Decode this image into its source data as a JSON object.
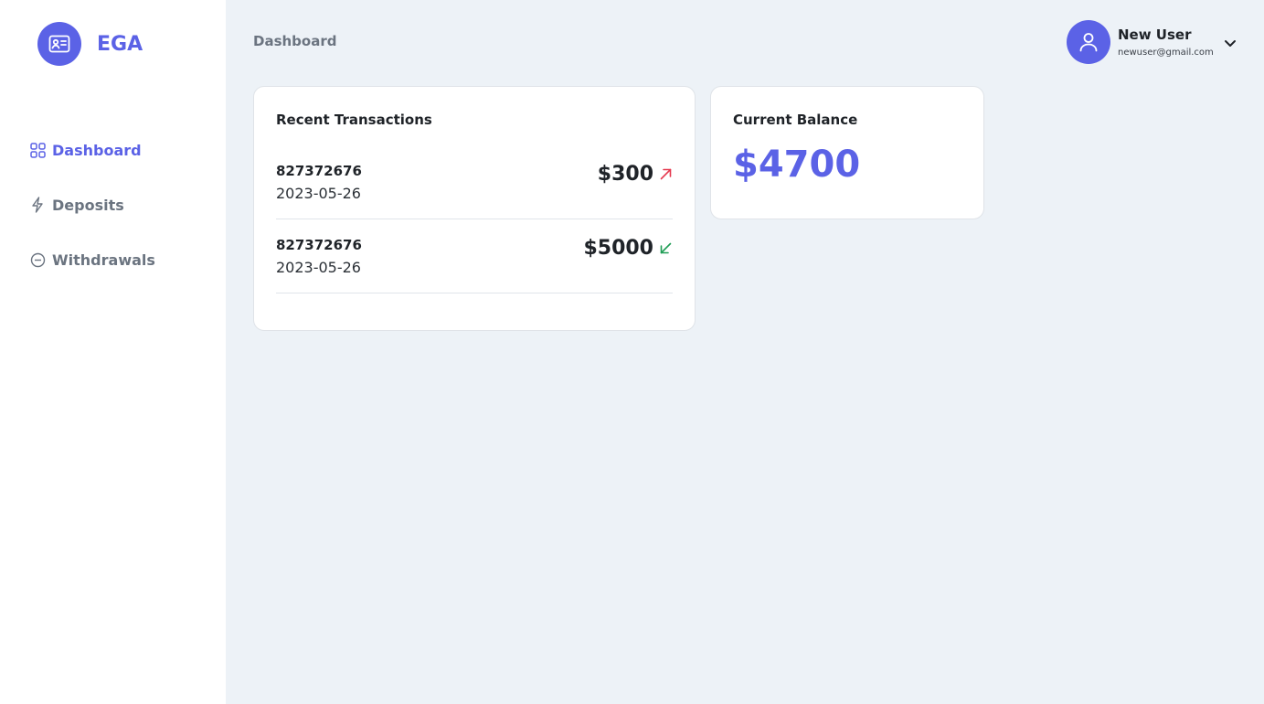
{
  "brand": {
    "name": "EGA",
    "logo_icon": "id-card-icon"
  },
  "sidebar": {
    "items": [
      {
        "label": "Dashboard",
        "icon": "grid-icon",
        "active": true
      },
      {
        "label": "Deposits",
        "icon": "lightning-icon",
        "active": false
      },
      {
        "label": "Withdrawals",
        "icon": "minus-circle-icon",
        "active": false
      }
    ]
  },
  "header": {
    "title": "Dashboard"
  },
  "user": {
    "name": "New User",
    "email": "newuser@gmail.com",
    "avatar_icon": "user-icon",
    "menu_icon": "chevron-down-icon"
  },
  "transactions": {
    "title": "Recent Transactions",
    "items": [
      {
        "id": "827372676",
        "date": "2023-05-26",
        "amount": "$300",
        "direction": "outgoing",
        "arrow_icon": "arrow-up-right-icon",
        "arrow_color": "#e5394f"
      },
      {
        "id": "827372676",
        "date": "2023-05-26",
        "amount": "$5000",
        "direction": "incoming",
        "arrow_icon": "arrow-down-left-icon",
        "arrow_color": "#1f9d55"
      }
    ]
  },
  "balance": {
    "title": "Current Balance",
    "value": "$4700"
  },
  "colors": {
    "accent": "#5b62e6",
    "background": "#edf2f7",
    "muted": "#6b7480"
  }
}
